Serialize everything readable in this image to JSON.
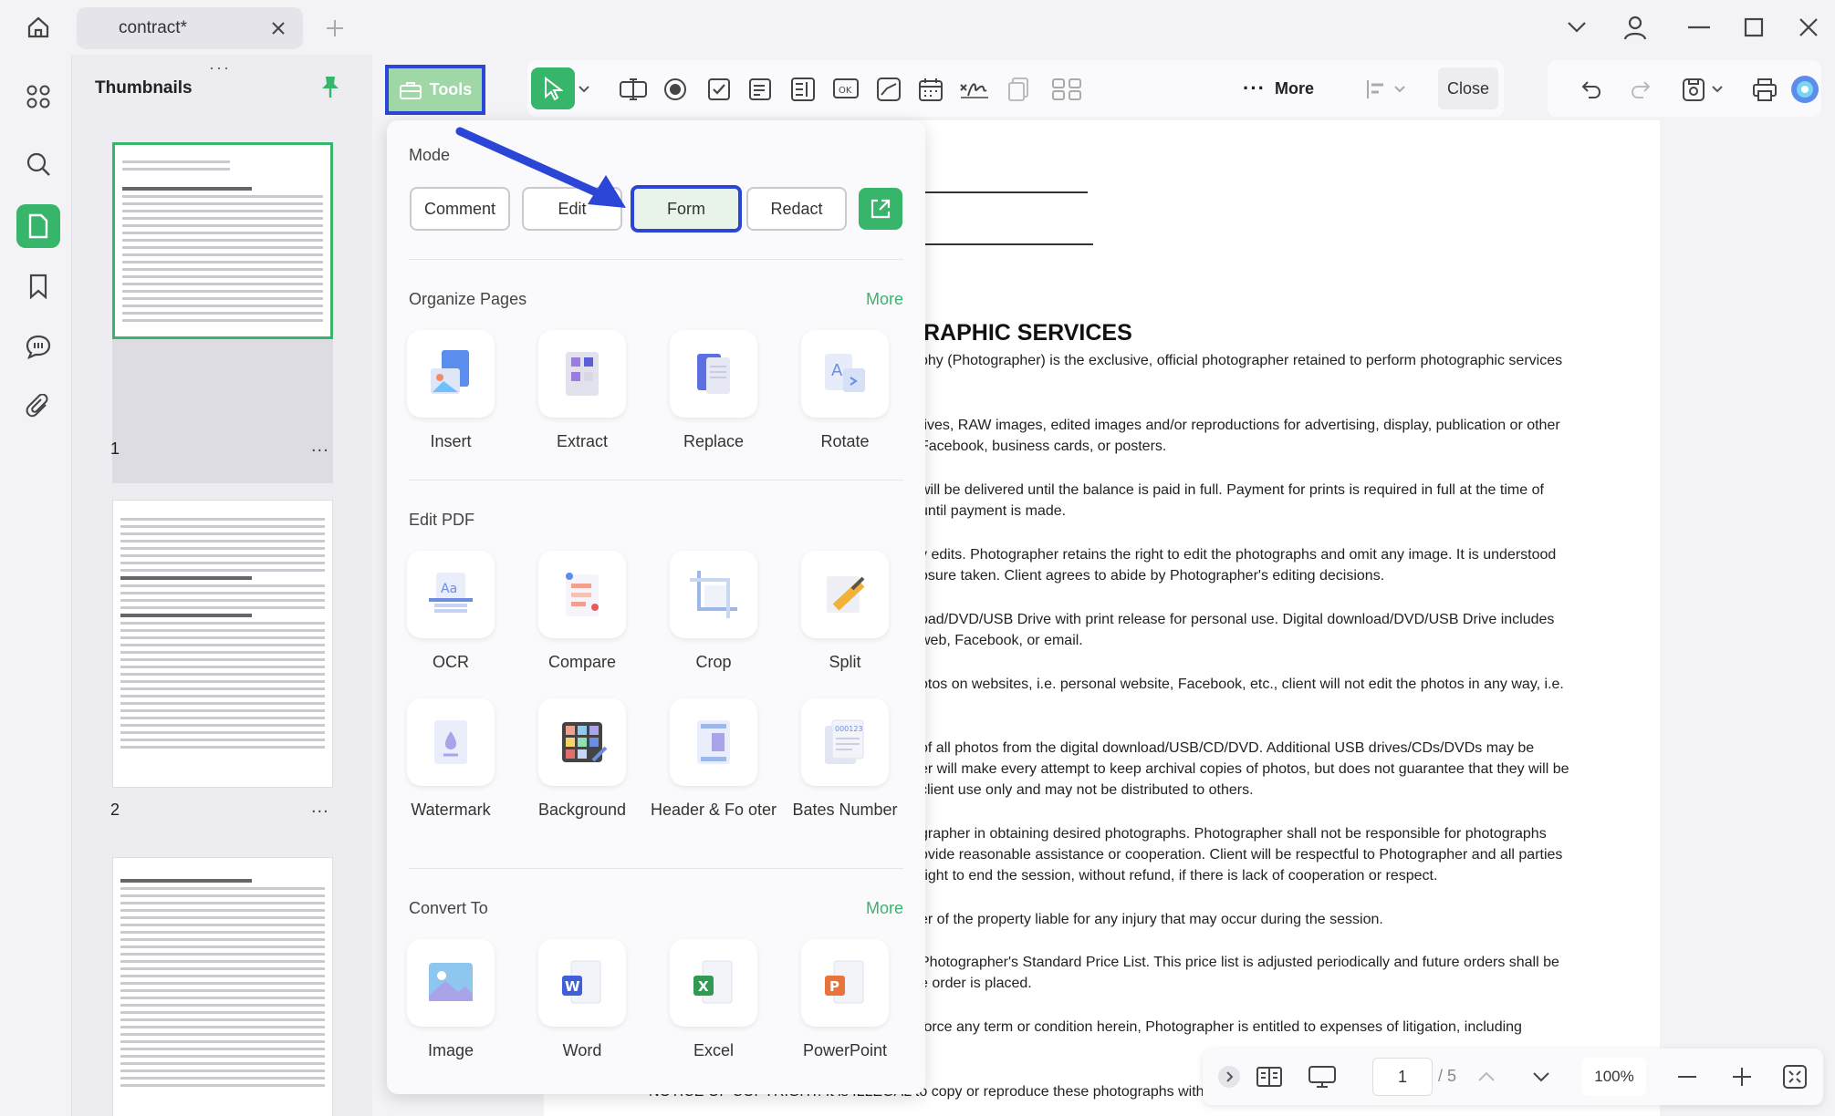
{
  "titlebar": {
    "tab_title": "contract*"
  },
  "thumbnails": {
    "title": "Thumbnails",
    "pages": [
      {
        "number": "1",
        "more": "..."
      },
      {
        "number": "2",
        "more": "..."
      }
    ]
  },
  "toolbar": {
    "tools_label": "Tools",
    "more_label": "More",
    "close_label": "Close"
  },
  "panel": {
    "mode_title": "Mode",
    "modes": [
      "Comment",
      "Edit",
      "Form",
      "Redact"
    ],
    "organize_title": "Organize Pages",
    "organize_more": "More",
    "organize_tools": [
      "Insert",
      "Extract",
      "Replace",
      "Rotate"
    ],
    "edit_title": "Edit PDF",
    "edit_tools": [
      "OCR",
      "Compare",
      "Crop",
      "Split",
      "Watermark",
      "Background",
      "Header & Fo oter",
      "Bates Number"
    ],
    "convert_title": "Convert To",
    "convert_more": "More",
    "convert_tools": [
      "Image",
      "Word",
      "Excel",
      "PowerPoint"
    ]
  },
  "document": {
    "heading": "RAPHIC SERVICES",
    "lines": [
      "phy (Photographer) is the exclusive, official photographer retained to perform photographic services",
      "tives, RAW images, edited images and/or reproductions for advertising, display, publication or other",
      "Facebook, business cards, or posters.",
      "will be delivered until the balance is paid in full. Payment for prints is required in full at the time of",
      "until payment is made.",
      "y edits. Photographer retains the right to edit the photographs and omit any image. It is understood",
      "osure taken. Client agrees to abide by Photographer's editing decisions.",
      "oad/DVD/USB Drive with print release for personal use. Digital download/DVD/USB Drive includes",
      "web, Facebook, or email.",
      "otos on websites, i.e. personal website, Facebook, etc., client will not edit the photos in any way, i.e.",
      "of all photos from the digital download/USB/CD/DVD. Additional USB drives/CDs/DVDs may be",
      "er will make every attempt to keep archival copies of photos, but does not guarantee that they will be",
      "client use only and may not be distributed to others.",
      "grapher in obtaining desired photographs. Photographer shall not be responsible for photographs",
      "ovide reasonable assistance or cooperation. Client will be respectful to Photographer and all parties",
      "right to end the session, without refund, if there is lack of cooperation or respect.",
      "er of the property liable for any injury that may occur during the session.",
      "Photographer's Standard Price List. This price list is adjusted periodically and future orders shall be",
      "e order is placed.",
      "force any term or condition herein, Photographer is entitled to expenses of litigation, including",
      "NOTICE OF COPYRIGHT: It is ILLEGAL to copy or reproduce these photographs without"
    ]
  },
  "navbar": {
    "page_current": "1",
    "page_total": "/ 5",
    "zoom": "100%"
  },
  "colors": {
    "accent": "#37b56a",
    "highlight": "#2b45d6"
  }
}
